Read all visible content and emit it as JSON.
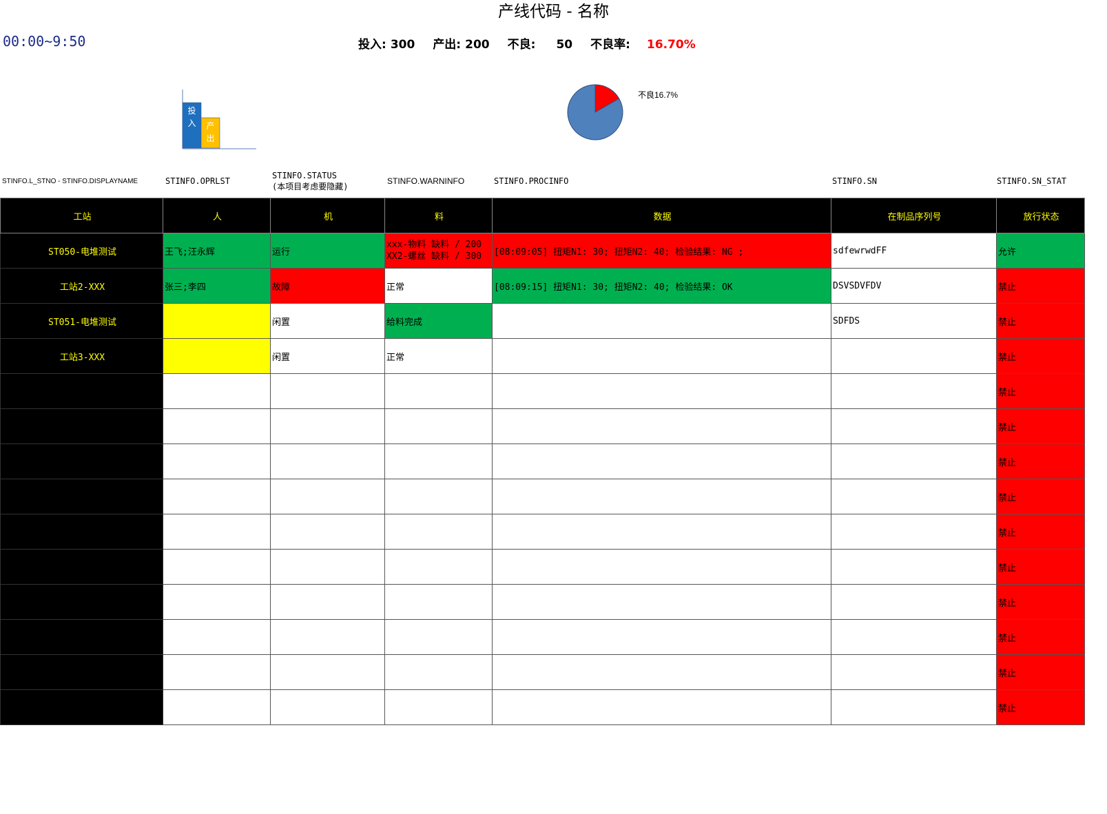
{
  "header": {
    "title": "产线代码 - 名称",
    "time_range": "00:00~9:50",
    "stats": {
      "input_label": "投入:",
      "input_value": "300",
      "output_label": "产出:",
      "output_value": "200",
      "defect_label": "不良:",
      "defect_value": "50",
      "rate_label": "不良率:",
      "rate_value": "16.70%"
    },
    "rate_color": "#ff0000"
  },
  "bar_chart": {
    "chart_data": {
      "type": "bar",
      "categories": [
        "投入",
        "产出"
      ],
      "values": [
        300,
        200
      ],
      "colors": [
        "#1f6fbf",
        "#ffc000"
      ]
    }
  },
  "pie_chart": {
    "chart_data": {
      "type": "pie",
      "slices": [
        {
          "label": "不良",
          "value": 16.7,
          "color": "#ff0000"
        },
        {
          "label": "",
          "value": 83.3,
          "color": "#4f81bd"
        }
      ],
      "slice_label": "不良16.7%"
    }
  },
  "field_row": {
    "f1": "STINFO.L_STNO - STINFO.DISPLAYNAME",
    "f2": "STINFO.OPRLST",
    "f3_line1": "STINFO.STATUS",
    "f3_line2": "(本项目考虑要隐藏)",
    "f4": "STINFO.WARNINFO",
    "f5": "STINFO.PROCINFO",
    "f6": "STINFO.SN",
    "f7": "STINFO.SN_STAT"
  },
  "table": {
    "headers": [
      "工站",
      "人",
      "机",
      "料",
      "数据",
      "在制品序列号",
      "放行状态"
    ],
    "rows": [
      {
        "station": "ST050-电堆测试",
        "person": "王飞;汪永辉",
        "machine": "运行",
        "material1": "xxx-物料 缺料 / 200",
        "material2": "XX2-螺丝 缺料 / 300",
        "data": "[08:09:05] 扭矩N1: 30; 扭矩N2: 40; 检验结果: NG ;",
        "sn": "sdfewrwdFF",
        "status": "允许"
      },
      {
        "station": "工站2-XXX",
        "person": "张三;李四",
        "machine": "故障",
        "material1": "正常",
        "material2": "",
        "data": "[08:09:15] 扭矩N1: 30; 扭矩N2: 40; 检验结果: OK",
        "sn": "DSVSDVFDV",
        "status": "禁止"
      },
      {
        "station": "ST051-电堆测试",
        "person": "",
        "machine": "闲置",
        "material1": "给料完成",
        "material2": "",
        "data": "",
        "sn": "SDFDS",
        "status": "禁止"
      },
      {
        "station": "工站3-XXX",
        "person": "",
        "machine": "闲置",
        "material1": "正常",
        "material2": "",
        "data": "",
        "sn": "",
        "status": "禁止"
      },
      {
        "station": "",
        "person": "",
        "machine": "",
        "material1": "",
        "material2": "",
        "data": "",
        "sn": "",
        "status": "禁止"
      },
      {
        "station": "",
        "person": "",
        "machine": "",
        "material1": "",
        "material2": "",
        "data": "",
        "sn": "",
        "status": "禁止"
      },
      {
        "station": "",
        "person": "",
        "machine": "",
        "material1": "",
        "material2": "",
        "data": "",
        "sn": "",
        "status": "禁止"
      },
      {
        "station": "",
        "person": "",
        "machine": "",
        "material1": "",
        "material2": "",
        "data": "",
        "sn": "",
        "status": "禁止"
      },
      {
        "station": "",
        "person": "",
        "machine": "",
        "material1": "",
        "material2": "",
        "data": "",
        "sn": "",
        "status": "禁止"
      },
      {
        "station": "",
        "person": "",
        "machine": "",
        "material1": "",
        "material2": "",
        "data": "",
        "sn": "",
        "status": "禁止"
      },
      {
        "station": "",
        "person": "",
        "machine": "",
        "material1": "",
        "material2": "",
        "data": "",
        "sn": "",
        "status": "禁止"
      },
      {
        "station": "",
        "person": "",
        "machine": "",
        "material1": "",
        "material2": "",
        "data": "",
        "sn": "",
        "status": "禁止"
      },
      {
        "station": "",
        "person": "",
        "machine": "",
        "material1": "",
        "material2": "",
        "data": "",
        "sn": "",
        "status": "禁止"
      },
      {
        "station": "",
        "person": "",
        "machine": "",
        "material1": "",
        "material2": "",
        "data": "",
        "sn": "",
        "status": "禁止"
      }
    ]
  },
  "colors": {
    "ok": "#00b050",
    "bad": "#ff0000",
    "warn": "#ffff00",
    "header_bg": "#000000",
    "header_text": "#ffff00"
  }
}
